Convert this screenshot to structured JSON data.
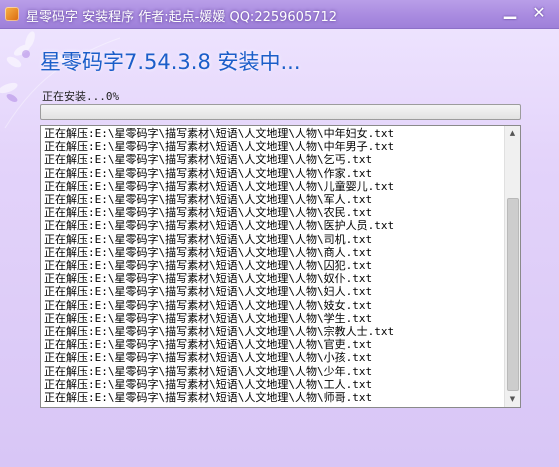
{
  "window": {
    "title": "星零码字 安装程序    作者:起点-媛媛  QQ:2259605712",
    "minimize_glyph": "▁",
    "close_glyph": "✕",
    "icon": "app-icon"
  },
  "header": {
    "title": "星零码字7.54.3.8 安装中..."
  },
  "status": {
    "text": "正在安装...0%",
    "progress_percent": 0
  },
  "log": {
    "lines": [
      "正在解压:E:\\星零码字\\描写素材\\短语\\人文地理\\人物\\中年妇女.txt",
      "正在解压:E:\\星零码字\\描写素材\\短语\\人文地理\\人物\\中年男子.txt",
      "正在解压:E:\\星零码字\\描写素材\\短语\\人文地理\\人物\\乞丐.txt",
      "正在解压:E:\\星零码字\\描写素材\\短语\\人文地理\\人物\\作家.txt",
      "正在解压:E:\\星零码字\\描写素材\\短语\\人文地理\\人物\\儿童婴儿.txt",
      "正在解压:E:\\星零码字\\描写素材\\短语\\人文地理\\人物\\军人.txt",
      "正在解压:E:\\星零码字\\描写素材\\短语\\人文地理\\人物\\农民.txt",
      "正在解压:E:\\星零码字\\描写素材\\短语\\人文地理\\人物\\医护人员.txt",
      "正在解压:E:\\星零码字\\描写素材\\短语\\人文地理\\人物\\司机.txt",
      "正在解压:E:\\星零码字\\描写素材\\短语\\人文地理\\人物\\商人.txt",
      "正在解压:E:\\星零码字\\描写素材\\短语\\人文地理\\人物\\囚犯.txt",
      "正在解压:E:\\星零码字\\描写素材\\短语\\人文地理\\人物\\奴仆.txt",
      "正在解压:E:\\星零码字\\描写素材\\短语\\人文地理\\人物\\妇人.txt",
      "正在解压:E:\\星零码字\\描写素材\\短语\\人文地理\\人物\\妓女.txt",
      "正在解压:E:\\星零码字\\描写素材\\短语\\人文地理\\人物\\学生.txt",
      "正在解压:E:\\星零码字\\描写素材\\短语\\人文地理\\人物\\宗教人士.txt",
      "正在解压:E:\\星零码字\\描写素材\\短语\\人文地理\\人物\\官吏.txt",
      "正在解压:E:\\星零码字\\描写素材\\短语\\人文地理\\人物\\小孩.txt",
      "正在解压:E:\\星零码字\\描写素材\\短语\\人文地理\\人物\\少年.txt",
      "正在解压:E:\\星零码字\\描写素材\\短语\\人文地理\\人物\\工人.txt",
      "正在解压:E:\\星零码字\\描写素材\\短语\\人文地理\\人物\\师哥.txt"
    ]
  },
  "scrollbar": {
    "up_glyph": "▲",
    "down_glyph": "▼"
  },
  "colors": {
    "title_text": "#1b5ec9",
    "titlebar": "#a98be0",
    "background": "#e3d3fa"
  }
}
